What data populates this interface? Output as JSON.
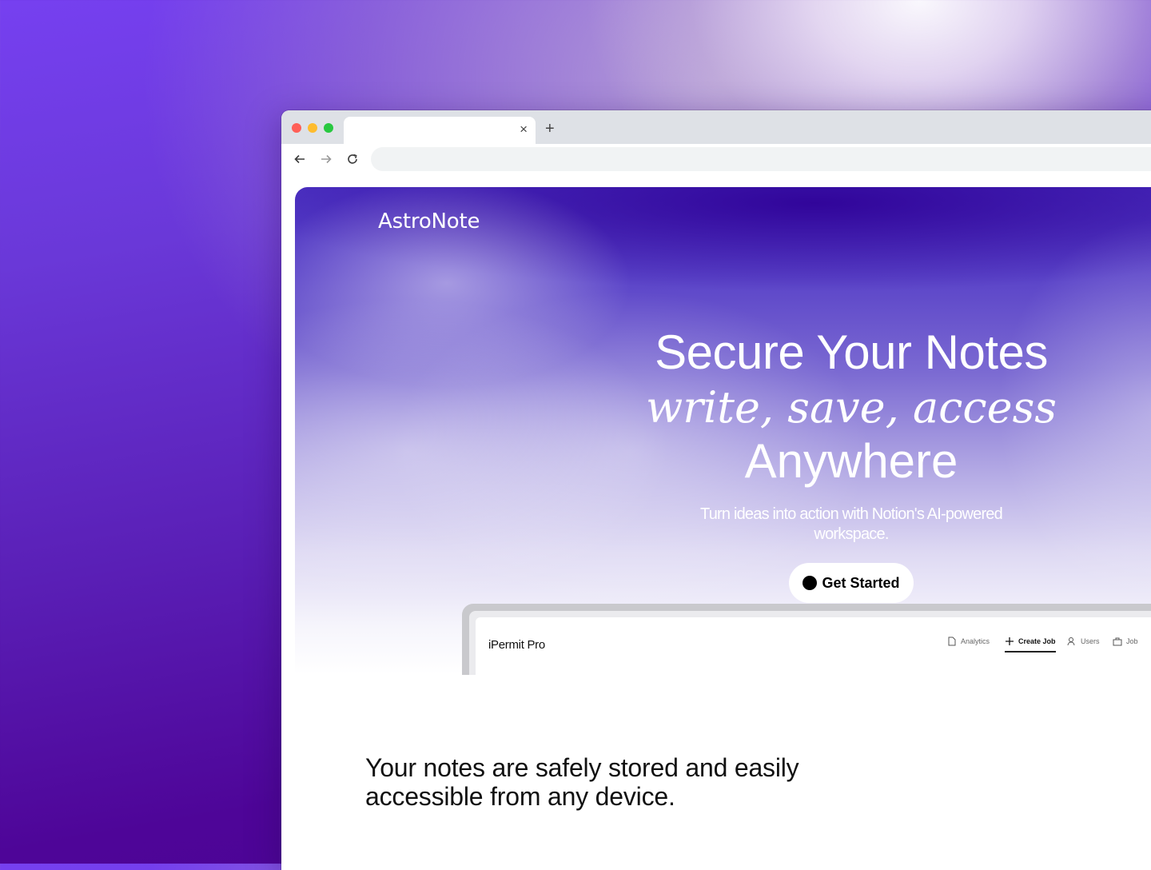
{
  "browser": {
    "tab_title": "",
    "tab_close_icon": "close-icon",
    "new_tab_icon": "plus-icon",
    "address_value": "",
    "nav_icons": [
      "back-arrow-icon",
      "forward-arrow-icon",
      "reload-icon"
    ],
    "window_dot_colors": [
      "#ff5f57",
      "#febc2e",
      "#28c840"
    ]
  },
  "site": {
    "brand": "AstroNote",
    "headline": "Secure Your Notes",
    "tagline": "write, save, access",
    "headline_end": "Anywhere",
    "subtitle": "Turn ideas into action with Notion's AI-powered workspace.",
    "cta_label": "Get Started"
  },
  "preview_app": {
    "title": "iPermit Pro",
    "nav": [
      {
        "label": "Analytics",
        "icon": "document-icon",
        "active": false
      },
      {
        "label": "Create Job",
        "icon": "plus-icon",
        "active": true
      },
      {
        "label": "Users",
        "icon": "users-icon",
        "active": false
      },
      {
        "label": "Job",
        "icon": "briefcase-icon",
        "active": false
      }
    ]
  },
  "section": {
    "description": "Your notes are safely stored and easily accessible from any device."
  },
  "colors": {
    "hero_top": "#4a2fc0",
    "background_deep": "#4e0598",
    "cta_background": "#ffffff"
  }
}
